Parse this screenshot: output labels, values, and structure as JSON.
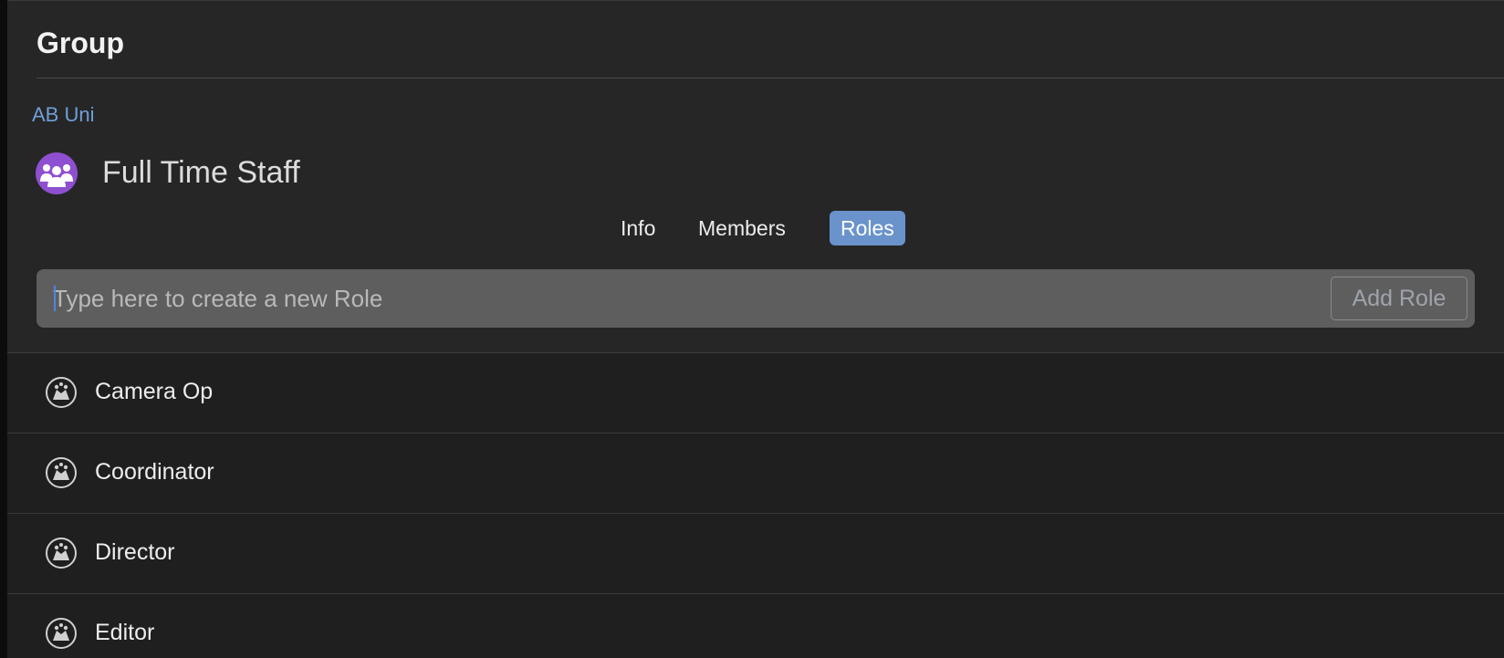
{
  "header": {
    "title": "Group",
    "breadcrumb": "AB Uni",
    "group_name": "Full Time Staff",
    "group_icon": "people-group-icon",
    "accent_color": "#8e4fd0"
  },
  "tabs": [
    {
      "label": "Info",
      "active": false
    },
    {
      "label": "Members",
      "active": false
    },
    {
      "label": "Roles",
      "active": true
    }
  ],
  "new_role": {
    "placeholder": "Type here to create a new Role",
    "value": "",
    "button_label": "Add Role"
  },
  "roles": [
    {
      "label": "Camera Op",
      "icon": "theater-masks-icon"
    },
    {
      "label": "Coordinator",
      "icon": "theater-masks-icon"
    },
    {
      "label": "Director",
      "icon": "theater-masks-icon"
    },
    {
      "label": "Editor",
      "icon": "theater-masks-icon"
    }
  ],
  "colors": {
    "tab_active": "#6a93cc",
    "link": "#6f9fda"
  }
}
